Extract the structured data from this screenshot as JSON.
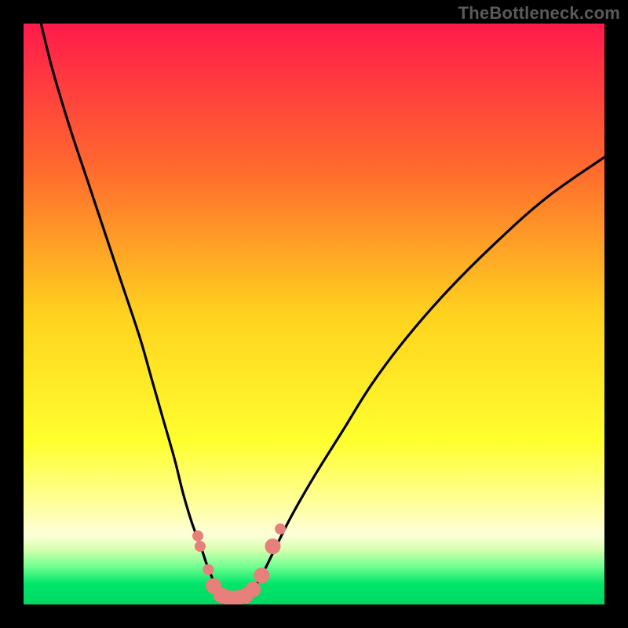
{
  "watermark": {
    "text": "TheBottleneck.com"
  },
  "chart_data": {
    "type": "line",
    "title": "",
    "xlabel": "",
    "ylabel": "",
    "xlim": [
      0,
      100
    ],
    "ylim": [
      0,
      100
    ],
    "gradient_stops": [
      {
        "offset": 0.0,
        "color": "#ff1a4b"
      },
      {
        "offset": 0.25,
        "color": "#ff6a2e"
      },
      {
        "offset": 0.5,
        "color": "#ffd21f"
      },
      {
        "offset": 0.72,
        "color": "#ffff2e"
      },
      {
        "offset": 0.83,
        "color": "#ffffa0"
      },
      {
        "offset": 0.88,
        "color": "#fdffd8"
      },
      {
        "offset": 0.905,
        "color": "#d9ffb0"
      },
      {
        "offset": 0.935,
        "color": "#6fff8f"
      },
      {
        "offset": 0.965,
        "color": "#00e56a"
      },
      {
        "offset": 1.0,
        "color": "#00d862"
      }
    ],
    "series": [
      {
        "name": "left-branch",
        "x": [
          3,
          5,
          8,
          11,
          14,
          17,
          20,
          22,
          24,
          26,
          27.5,
          29,
          30.5,
          31.5,
          32.5,
          33.3
        ],
        "y": [
          100,
          92,
          82,
          73,
          64,
          55,
          46,
          39,
          32,
          25,
          19,
          14,
          10,
          7,
          4.5,
          2.5
        ]
      },
      {
        "name": "right-branch",
        "x": [
          39.5,
          41,
          43,
          46,
          50,
          55,
          60,
          66,
          73,
          81,
          90,
          100
        ],
        "y": [
          2.5,
          5,
          9,
          15,
          22,
          30,
          38,
          46,
          54,
          62,
          70,
          77
        ]
      },
      {
        "name": "valley-floor",
        "x": [
          33.3,
          34.5,
          36,
          37.5,
          39.5
        ],
        "y": [
          2.5,
          1.2,
          0.9,
          1.2,
          2.5
        ]
      }
    ],
    "markers": {
      "name": "pink-dots",
      "color": "#e77f7a",
      "radius_small": 7,
      "radius_large": 10,
      "points": [
        {
          "x": 30.0,
          "y": 11.8,
          "r": 7
        },
        {
          "x": 30.4,
          "y": 10.0,
          "r": 7
        },
        {
          "x": 31.8,
          "y": 6.0,
          "r": 7
        },
        {
          "x": 32.7,
          "y": 3.2,
          "r": 10
        },
        {
          "x": 34.0,
          "y": 1.6,
          "r": 10
        },
        {
          "x": 35.4,
          "y": 1.1,
          "r": 10
        },
        {
          "x": 36.8,
          "y": 1.1,
          "r": 10
        },
        {
          "x": 38.2,
          "y": 1.5,
          "r": 10
        },
        {
          "x": 39.5,
          "y": 2.6,
          "r": 10
        },
        {
          "x": 41.0,
          "y": 5.0,
          "r": 10
        },
        {
          "x": 42.9,
          "y": 10.0,
          "r": 10
        },
        {
          "x": 44.2,
          "y": 13.0,
          "r": 7
        }
      ]
    }
  }
}
